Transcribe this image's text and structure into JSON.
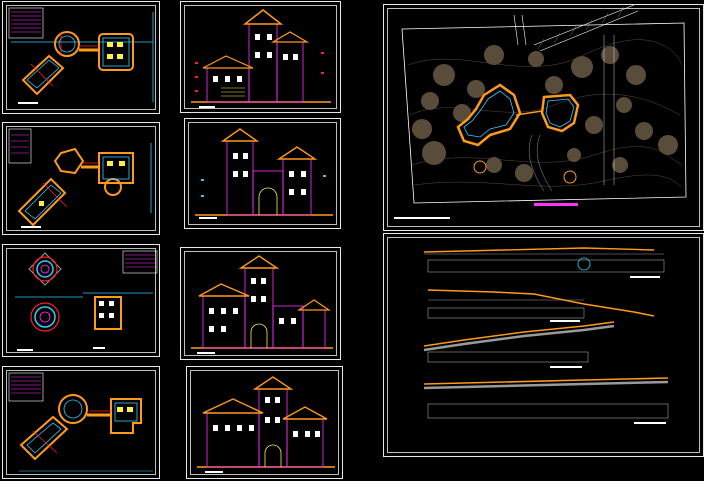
{
  "drawing": {
    "background": "#000000",
    "colors": {
      "frame": "#ffffff",
      "wall": "#ff9a1a",
      "cyan": "#33ccff",
      "magenta": "#ff33ff",
      "red": "#ff2020",
      "yellow": "#ffee44",
      "tree": "#5a4c3a",
      "grey": "#9a9a9a"
    },
    "sheets": [
      {
        "name": "floor-plan-sheet-1",
        "kind": "plan"
      },
      {
        "name": "floor-plan-sheet-2",
        "kind": "plan"
      },
      {
        "name": "tower-plans-sheet",
        "kind": "plan"
      },
      {
        "name": "floor-plan-sheet-4",
        "kind": "plan"
      },
      {
        "name": "elevation-sheet-1",
        "kind": "elevation"
      },
      {
        "name": "elevation-sheet-2",
        "kind": "elevation"
      },
      {
        "name": "elevation-sheet-3",
        "kind": "elevation"
      },
      {
        "name": "elevation-sheet-4",
        "kind": "elevation"
      },
      {
        "name": "site-plan-sheet",
        "kind": "site"
      },
      {
        "name": "terrain-sections-sheet",
        "kind": "section"
      }
    ]
  }
}
